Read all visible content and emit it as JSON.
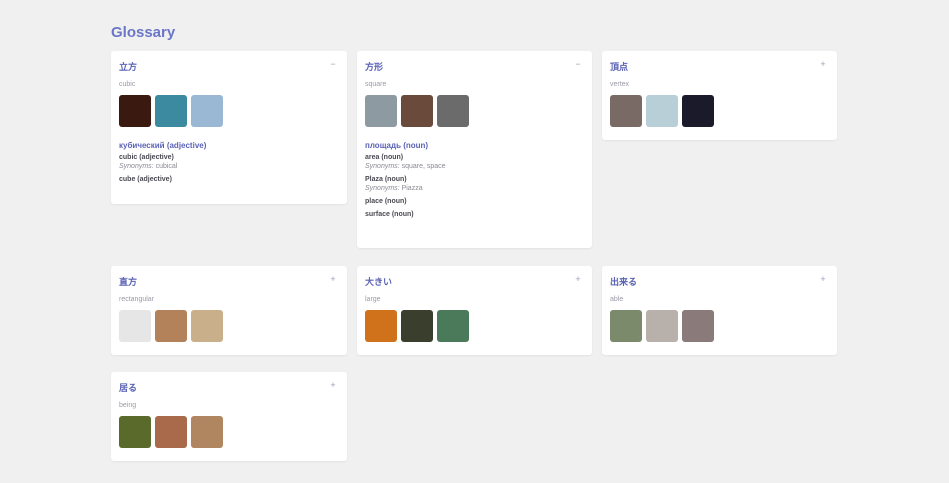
{
  "page": {
    "title": "Glossary"
  },
  "colors": {
    "accent": "#6b76c8",
    "card_bg": "#ffffff",
    "page_bg": "#f0f0f0"
  },
  "cards": [
    {
      "word": "立方",
      "toggle": "−",
      "translit": "cubic",
      "images": [
        {
          "name": "dark swirl",
          "color": "#3a1a10"
        },
        {
          "name": "cube sculpture",
          "color": "#3c8aa0"
        },
        {
          "name": "snowy mountain",
          "color": "#9ab8d4"
        }
      ],
      "definitions": {
        "title": "кубический (adjective)",
        "synonyms_label": "Synonyms:",
        "senses": [
          {
            "term": "cubic (adjective)",
            "synonyms": "cubical"
          },
          {
            "term": "cube (adjective)",
            "synonyms": ""
          }
        ]
      }
    },
    {
      "word": "方形",
      "toggle": "−",
      "translit": "square",
      "images": [
        {
          "name": "building",
          "color": "#8d9aa2"
        },
        {
          "name": "square table",
          "color": "#6a4a3a"
        },
        {
          "name": "plaza building",
          "color": "#6b6b6b"
        }
      ],
      "definitions": {
        "title": "площадь (noun)",
        "synonyms_label": "Synonyms:",
        "senses": [
          {
            "term": "area (noun)",
            "synonyms": "square, space"
          },
          {
            "term": "Plaza (noun)",
            "synonyms": "Piazza"
          },
          {
            "term": "place (noun)",
            "synonyms": ""
          },
          {
            "term": "surface (noun)",
            "synonyms": ""
          }
        ]
      }
    },
    {
      "word": "頂点",
      "toggle": "+",
      "translit": "vertex",
      "images": [
        {
          "name": "mountain peak",
          "color": "#7a6a66"
        },
        {
          "name": "snowy peaks",
          "color": "#b8cfd8"
        },
        {
          "name": "city lights",
          "color": "#1a1a2a"
        }
      ]
    },
    {
      "word": "直方",
      "toggle": "+",
      "translit": "rectangular",
      "images": [
        {
          "name": "white box",
          "color": "#e6e6e6"
        },
        {
          "name": "wood texture",
          "color": "#b4825a"
        },
        {
          "name": "bottle",
          "color": "#c9b08a"
        }
      ]
    },
    {
      "word": "大きい",
      "toggle": "+",
      "translit": "large",
      "images": [
        {
          "name": "orange",
          "color": "#d0721c"
        },
        {
          "name": "forest",
          "color": "#3a3e2c"
        },
        {
          "name": "leaves",
          "color": "#4a7a5a"
        }
      ]
    },
    {
      "word": "出来る",
      "toggle": "+",
      "translit": "able",
      "images": [
        {
          "name": "plant pot",
          "color": "#7a8a6a"
        },
        {
          "name": "person hands",
          "color": "#b8b0aa"
        },
        {
          "name": "landscape",
          "color": "#8a7a7a"
        }
      ]
    },
    {
      "word": "居る",
      "toggle": "+",
      "translit": "being",
      "images": [
        {
          "name": "field",
          "color": "#5a6a2a"
        },
        {
          "name": "building front",
          "color": "#a86a4a"
        },
        {
          "name": "sand texture",
          "color": "#b08660"
        }
      ]
    }
  ]
}
